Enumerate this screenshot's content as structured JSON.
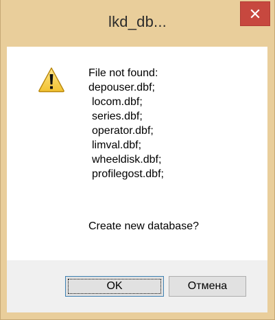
{
  "window": {
    "title": "lkd_db...",
    "close_icon": "close-icon"
  },
  "message": {
    "icon": "warning-icon",
    "header": "File not found:",
    "files": [
      "depouser.dbf;",
      "locom.dbf;",
      "series.dbf;",
      "operator.dbf;",
      "limval.dbf;",
      "wheeldisk.dbf;",
      "profilegost.dbf;"
    ],
    "question": "Create new database?"
  },
  "buttons": {
    "ok_label": "OK",
    "cancel_label": "Отмена"
  },
  "colors": {
    "frame": "#e9ce9b",
    "close_button": "#c7483f",
    "footer": "#f0f0f0",
    "warning_fill": "#f7d44a"
  }
}
